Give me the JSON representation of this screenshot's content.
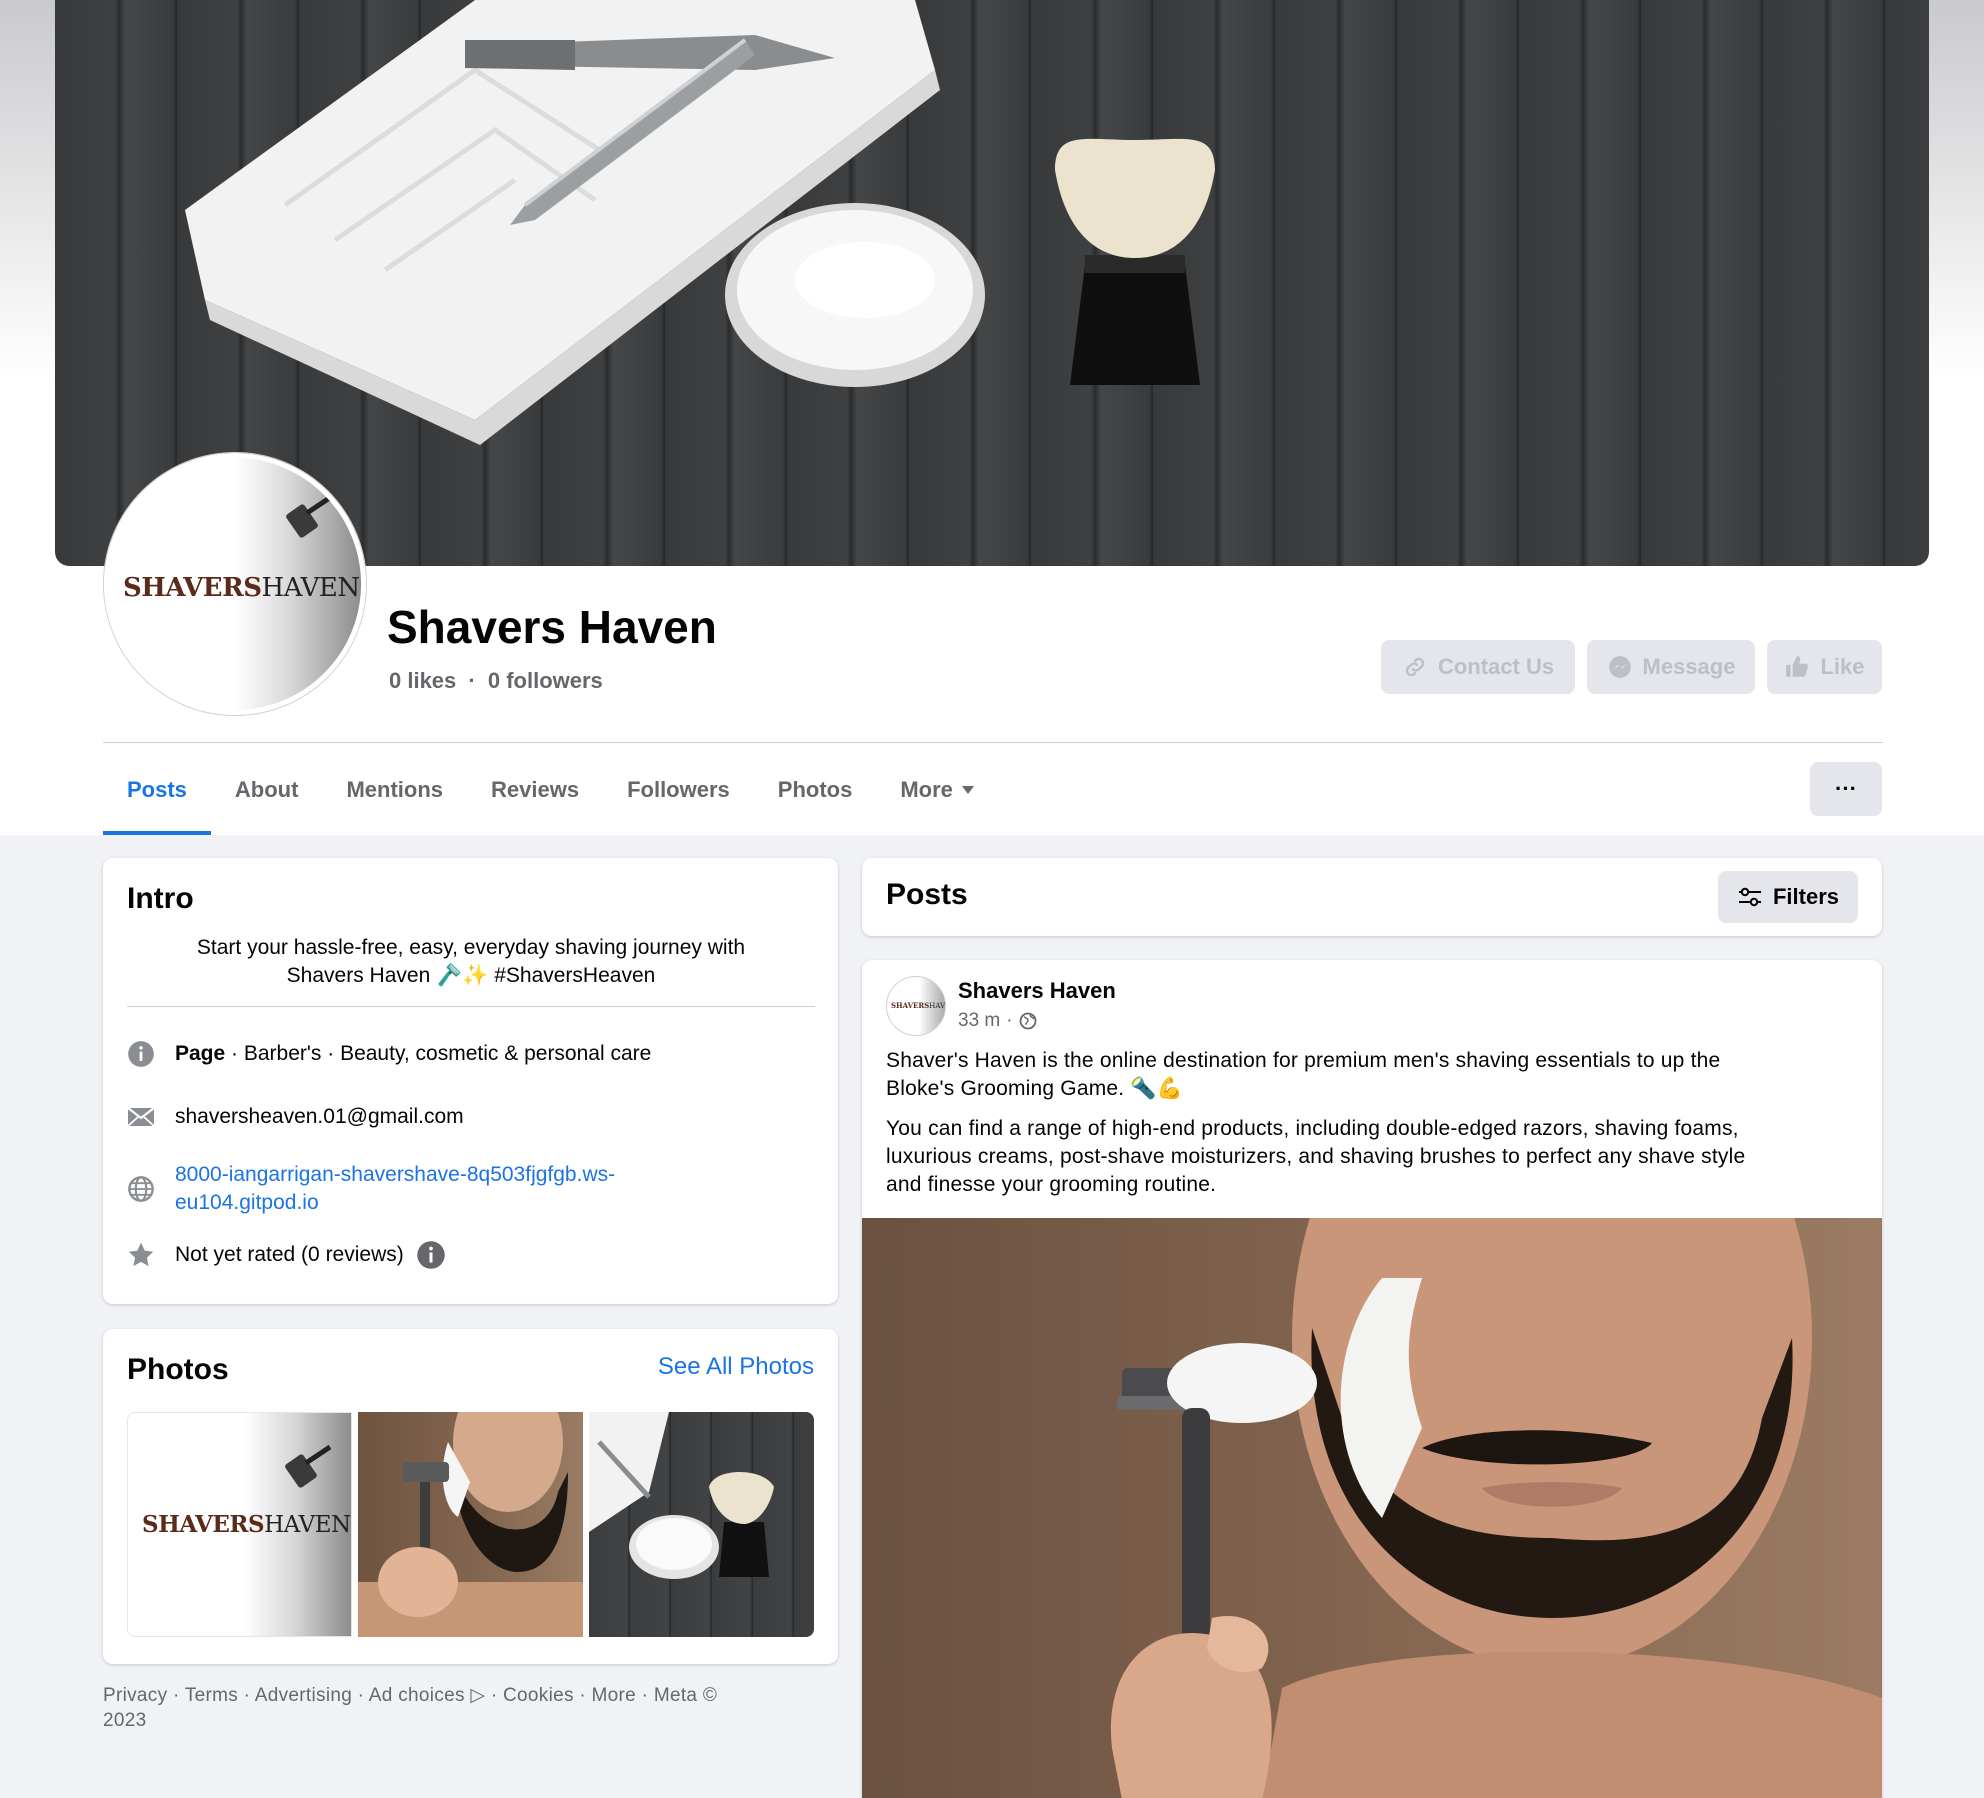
{
  "page": {
    "name": "Shavers Haven",
    "likes": "0 likes",
    "followers": "0 followers",
    "stats_sep": "·"
  },
  "logo": {
    "part1": "SHAVERS",
    "part2": "HAVEN"
  },
  "actions": {
    "contact": "Contact Us",
    "message": "Message",
    "like": "Like"
  },
  "tabs": [
    {
      "label": "Posts",
      "active": true
    },
    {
      "label": "About"
    },
    {
      "label": "Mentions"
    },
    {
      "label": "Reviews"
    },
    {
      "label": "Followers"
    },
    {
      "label": "Photos"
    },
    {
      "label": "More"
    }
  ],
  "more_options": "···",
  "intro": {
    "title": "Intro",
    "bio_line1": "Start your hassle-free, easy, everyday shaving journey with",
    "bio_line2": "Shavers Haven 🪒✨ #ShaversHeaven",
    "category_bold": "Page",
    "category_rest": " · Barber's · Beauty, cosmetic & personal care",
    "email": "shaversheaven.01@gmail.com",
    "website_line1": "8000-iangarrigan-shavershave-8q503fjgfgb.ws-",
    "website_line2": "eu104.gitpod.io",
    "rating": "Not yet rated (0 reviews)"
  },
  "photos": {
    "title": "Photos",
    "see_all": "See All Photos"
  },
  "footer": {
    "line1": "Privacy · Terms · Advertising · Ad choices ▷ · Cookies · More · Meta ©",
    "line2": "2023"
  },
  "posts_header": {
    "title": "Posts",
    "filters": "Filters"
  },
  "post": {
    "author": "Shavers Haven",
    "time": "33 m",
    "meta_sep": "·",
    "p1_line1": "Shaver's Haven is the online destination for premium men's shaving essentials to up the",
    "p1_line2": "Bloke's Grooming Game. 🔦💪",
    "p2_line1": "You can find a range of high-end products, including double-edged razors, shaving foams,",
    "p2_line2": "luxurious creams, post-shave moisturizers, and shaving brushes to perfect any shave style",
    "p2_line3": "and finesse your grooming routine."
  },
  "colors": {
    "accent": "#1b74e4",
    "background": "#f0f2f5",
    "logo_brown": "#5a2a1a"
  }
}
